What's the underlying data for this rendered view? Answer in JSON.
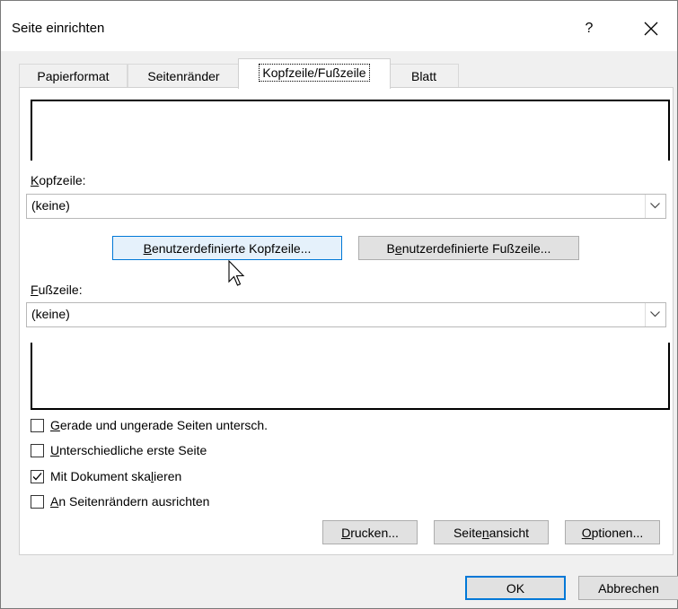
{
  "window": {
    "title": "Seite einrichten",
    "help_glyph": "?"
  },
  "tabs": [
    {
      "label": "Papierformat",
      "active": false
    },
    {
      "label": "Seitenränder",
      "active": false
    },
    {
      "label": "Kopfzeile/Fußzeile",
      "active": true
    },
    {
      "label": "Blatt",
      "active": false
    }
  ],
  "header": {
    "label_mnemonic": "K",
    "label_rest": "opfzeile:",
    "value": "(keine)"
  },
  "footer": {
    "label_mnemonic": "F",
    "label_rest": "ußzeile:",
    "value": "(keine)"
  },
  "custom_buttons": {
    "header_mnemonic": "B",
    "header_rest": "enutzerdefinierte Kopfzeile...",
    "footer_pre": "B",
    "footer_mnemonic": "e",
    "footer_rest": "nutzerdefinierte Fußzeile..."
  },
  "options": [
    {
      "pre": "",
      "mnemonic": "G",
      "post": "erade und ungerade Seiten untersch.",
      "checked": false
    },
    {
      "pre": "",
      "mnemonic": "U",
      "post": "nterschiedliche erste Seite",
      "checked": false
    },
    {
      "pre": "Mit Dokument ska",
      "mnemonic": "l",
      "post": "ieren",
      "checked": true
    },
    {
      "pre": "",
      "mnemonic": "A",
      "post": "n Seitenrändern ausrichten",
      "checked": false
    }
  ],
  "action_buttons": {
    "print_mnemonic": "D",
    "print_rest": "rucken...",
    "preview_pre": "Seite",
    "preview_mnemonic": "n",
    "preview_rest": "ansicht",
    "options_mnemonic": "O",
    "options_rest": "ptionen..."
  },
  "footer_buttons": {
    "ok": "OK",
    "cancel": "Abbrechen"
  },
  "colors": {
    "accent": "#0078d7",
    "dialog_bg": "#f0f0f0",
    "button_bg": "#e1e1e1"
  }
}
